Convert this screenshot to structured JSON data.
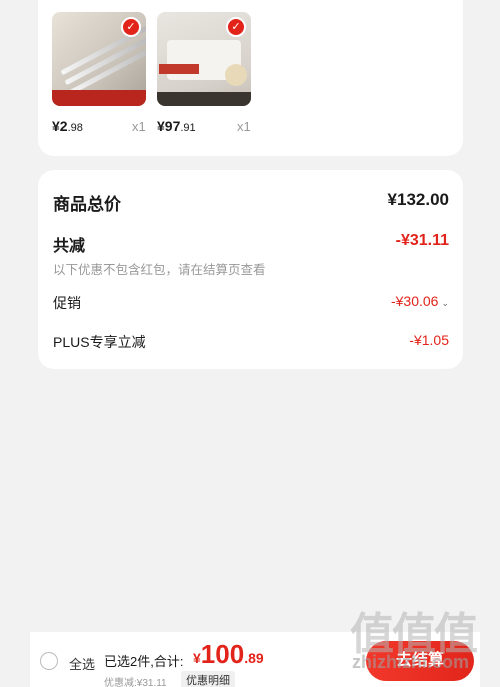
{
  "products": [
    {
      "price_int": "¥2",
      "price_dec": ".98",
      "qty": "x1",
      "selected": true
    },
    {
      "price_int": "¥97",
      "price_dec": ".91",
      "qty": "x1",
      "selected": true
    }
  ],
  "summary": {
    "total_label": "商品总价",
    "total_value": "¥132.00",
    "reduce_label": "共减",
    "reduce_value": "-¥31.11",
    "note": "以下优惠不包含红包，请在结算页查看",
    "promo_label": "促销",
    "promo_value": "-¥30.06",
    "plus_label": "PLUS专享立减",
    "plus_value": "-¥1.05"
  },
  "bottom": {
    "select_all": "全选",
    "selected_count": "已选2件,合计:",
    "total_yen": "¥",
    "total_int": "100",
    "total_dec": ".89",
    "discount": "优惠减:¥31.11",
    "detail": "优惠明细",
    "checkout": "去结算"
  },
  "watermark": {
    "text": "值值值",
    "url": "zhizhizhi.com"
  },
  "colors": {
    "accent": "#e2231a",
    "card": "#ffffff",
    "page": "#f2f2f2"
  }
}
